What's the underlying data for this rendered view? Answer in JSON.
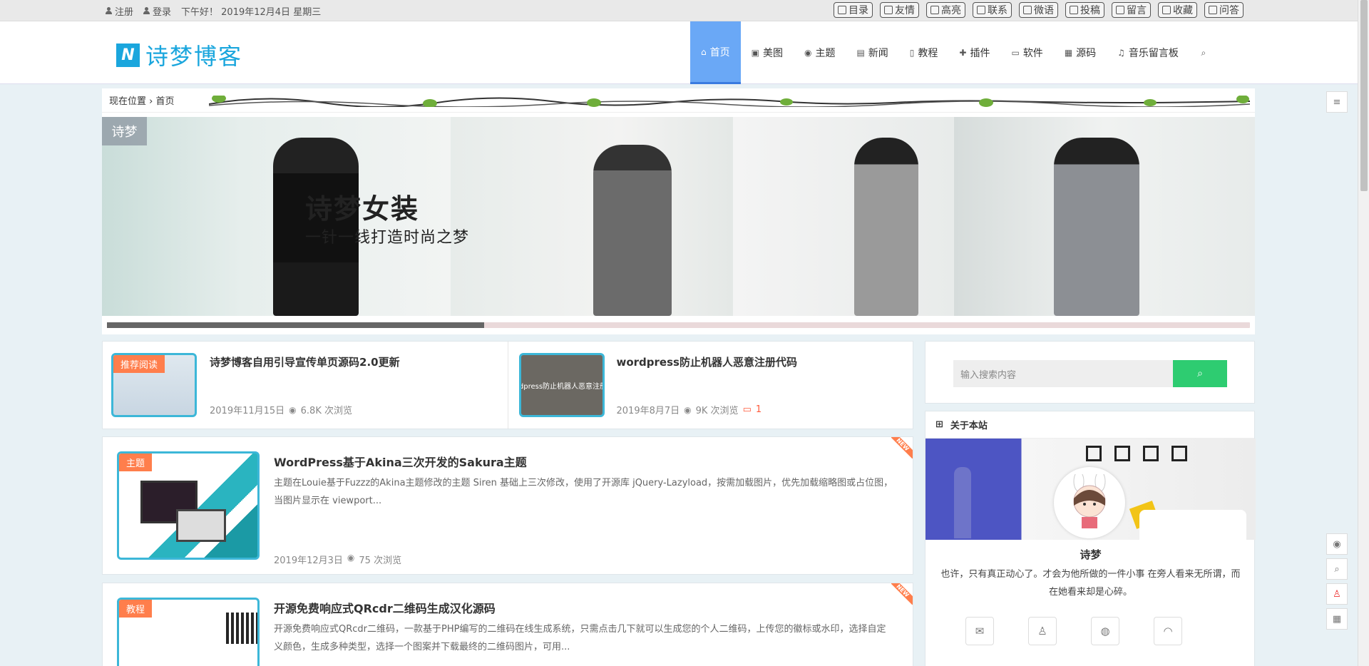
{
  "topbar": {
    "register": "注册",
    "login": "登录",
    "greeting": "下午好！ 2019年12月4日 星期三",
    "buttons": [
      {
        "label": "目录",
        "icon": "list-icon"
      },
      {
        "label": "友情",
        "icon": "link-icon"
      },
      {
        "label": "高亮",
        "icon": "pen-icon"
      },
      {
        "label": "联系",
        "icon": "contact-icon"
      },
      {
        "label": "微语",
        "icon": "note-icon"
      },
      {
        "label": "投稿",
        "icon": "edit-icon"
      },
      {
        "label": "留言",
        "icon": "message-icon"
      },
      {
        "label": "收藏",
        "icon": "bookmark-icon"
      },
      {
        "label": "问答",
        "icon": "question-icon"
      }
    ]
  },
  "header": {
    "logo_text": "诗梦博客",
    "logo_mark": "N",
    "nav": [
      {
        "label": "首页",
        "icon": "⌂",
        "active": true
      },
      {
        "label": "美图",
        "icon": "▣"
      },
      {
        "label": "主题",
        "icon": "◉"
      },
      {
        "label": "新闻",
        "icon": "▤"
      },
      {
        "label": "教程",
        "icon": "▯"
      },
      {
        "label": "插件",
        "icon": "✚"
      },
      {
        "label": "软件",
        "icon": "▭"
      },
      {
        "label": "源码",
        "icon": "▦"
      },
      {
        "label": "音乐留言板",
        "icon": "♫"
      }
    ],
    "search_icon": "⌕"
  },
  "banner": {
    "breadcrumb": "现在位置 › 首页",
    "tag": "诗梦",
    "title": "诗梦女装",
    "subtitle": "一针一线打造时尚之梦",
    "progress": 0.33
  },
  "featured": [
    {
      "badge": "推荐阅读",
      "title": "诗梦博客自用引导宣传单页源码2.0更新",
      "date": "2019年11月15日",
      "views": "6.8K 次浏览"
    },
    {
      "badge": "",
      "thumb_text": "rdpress防止机器人恶意注册",
      "title": "wordpress防止机器人恶意注册代码",
      "date": "2019年8月7日",
      "views": "9K 次浏览",
      "comments": "1"
    }
  ],
  "posts": [
    {
      "badge": "主题",
      "title": "WordPress基于Akina三次开发的Sakura主题",
      "excerpt": "主题在Louie基于Fuzzz的Akina主题修改的主题 Siren 基础上三次修改，使用了开源库 jQuery-Lazyload，按需加载图片，优先加载缩略图或占位图，当图片显示在 viewport...",
      "date": "2019年12月3日",
      "views": "75 次浏览",
      "ribbon": "NEW"
    },
    {
      "badge": "教程",
      "title": "开源免费响应式QRcdr二维码生成汉化源码",
      "excerpt": "开源免费响应式QRcdr二维码，一款基于PHP编写的二维码在线生成系统，只需点击几下就可以生成您的个人二维码，上传您的徽标或水印，选择自定义颜色，生成多种类型，选择一个图案并下载最终的二维码图片，可用...",
      "date": "",
      "views": "",
      "ribbon": "NEW"
    }
  ],
  "sidebar": {
    "search_placeholder": "输入搜索内容",
    "about_title": "关于本站",
    "name": "诗梦",
    "desc": "也许，只有真正动心了。才会为他所做的一件小事 在旁人看来无所谓，而在她看来却是心碎。"
  }
}
